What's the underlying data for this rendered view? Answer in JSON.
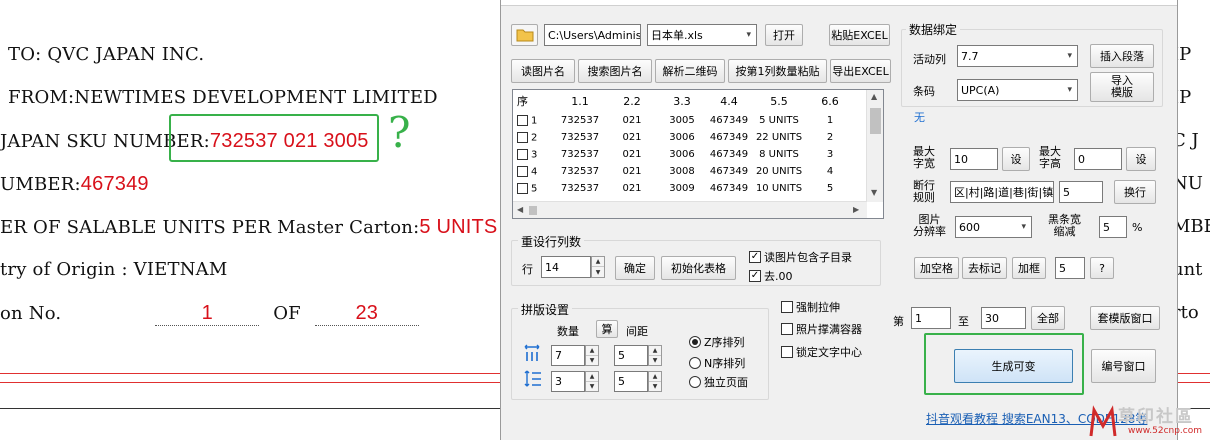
{
  "document": {
    "line_to": "TO: QVC JAPAN INC.",
    "line_from": "FROM:NEWTIMES DEVELOPMENT LIMITED",
    "line_sku_label": "JAPAN SKU NUMBER:",
    "line_sku_value": "732537 021 3005",
    "line_number_label": "UMBER:",
    "line_number_value": "467349",
    "line_units_label": "ER OF SALABLE UNITS PER Master Carton:",
    "line_units_value": "5 UNITS",
    "line_origin": "try of Origin :  VIETNAM",
    "line_carton_label": "on No.",
    "line_carton_current": "1",
    "line_carton_of": "OF",
    "line_carton_total": "23",
    "annotation_mark": "?",
    "right_fragments": [
      "IP",
      "IP",
      "C J",
      "NU",
      "MBE",
      "unt",
      "rto"
    ]
  },
  "dialog": {
    "path_value": "C:\\Users\\Administ",
    "file_select": "日本单.xls",
    "btn_open": "打开",
    "btn_paste_excel": "粘贴EXCEL",
    "btn_read_image_name": "读图片名",
    "btn_search_image_name": "搜索图片名",
    "btn_parse_qr": "解析二维码",
    "btn_paste_by_qty": "按第1列数量粘贴",
    "btn_export_excel": "导出EXCEL",
    "table": {
      "headers": [
        "序",
        "1.1",
        "2.2",
        "3.3",
        "4.4",
        "5.5",
        "6.6"
      ],
      "rows": [
        [
          "1",
          "732537",
          "021",
          "3005",
          "467349",
          "5 UNITS",
          "1"
        ],
        [
          "2",
          "732537",
          "021",
          "3006",
          "467349",
          "22 UNITS",
          "2"
        ],
        [
          "3",
          "732537",
          "021",
          "3006",
          "467349",
          "8 UNITS",
          "3"
        ],
        [
          "4",
          "732537",
          "021",
          "3008",
          "467349",
          "20 UNITS",
          "4"
        ],
        [
          "5",
          "732537",
          "021",
          "3009",
          "467349",
          "10 UNITS",
          "5"
        ]
      ]
    },
    "reset_group_title": "重设行列数",
    "rows_label": "行",
    "rows_value": "14",
    "btn_confirm": "确定",
    "btn_init_table": "初始化表格",
    "chk_subfolder": "读图片包含子目录",
    "chk_remove_00": "去.00",
    "imposition_title": "拼版设置",
    "qty_label": "数量",
    "btn_calc": "算",
    "spacing_label": "间距",
    "qty_cols": "7",
    "qty_rows": "3",
    "gap_cols": "5",
    "gap_rows": "5",
    "radio_z": "Z序排列",
    "radio_n": "N序排列",
    "radio_page": "独立页面",
    "chk_force_stretch": "强制拉伸",
    "chk_fill_container": "照片撑满容器",
    "chk_lock_center": "锁定文字中心",
    "binding_title": "数据绑定",
    "active_col_label": "活动列",
    "active_col_value": "7.7",
    "btn_insert_para": "插入段落",
    "barcode_label": "条码",
    "barcode_value": "UPC(A)",
    "btn_import_template": "导入\n模版",
    "none_label": "无",
    "max_width_label": "最大\n字宽",
    "max_width_value": "10",
    "max_height_label": "最大\n字高",
    "max_height_value": "0",
    "btn_set": "设",
    "line_break_label": "断行\n规则",
    "line_break_value": "区|村|路|道|巷|街|镇",
    "line_break_num": "5",
    "btn_wrap": "换行",
    "resolution_label": "图片\n分辨率",
    "resolution_value": "600",
    "bar_shrink_label": "黑条宽\n缩减",
    "bar_shrink_value": "5",
    "percent": "%",
    "btn_add_space": "加空格",
    "btn_remove_mark": "去标记",
    "btn_add_frame": "加框",
    "frame_value": "5",
    "btn_help": "?",
    "page_prefix": "第",
    "page_from": "1",
    "page_to_label": "至",
    "page_to": "30",
    "btn_all": "全部",
    "btn_template_window": "套模版窗口",
    "btn_generate": "生成可变",
    "btn_number_window": "编号窗口",
    "footer_link": "抖音观看教程 搜索EAN13、CODE128等",
    "watermark_text": "草印社區",
    "watermark_url": "www.52cnp.com"
  }
}
